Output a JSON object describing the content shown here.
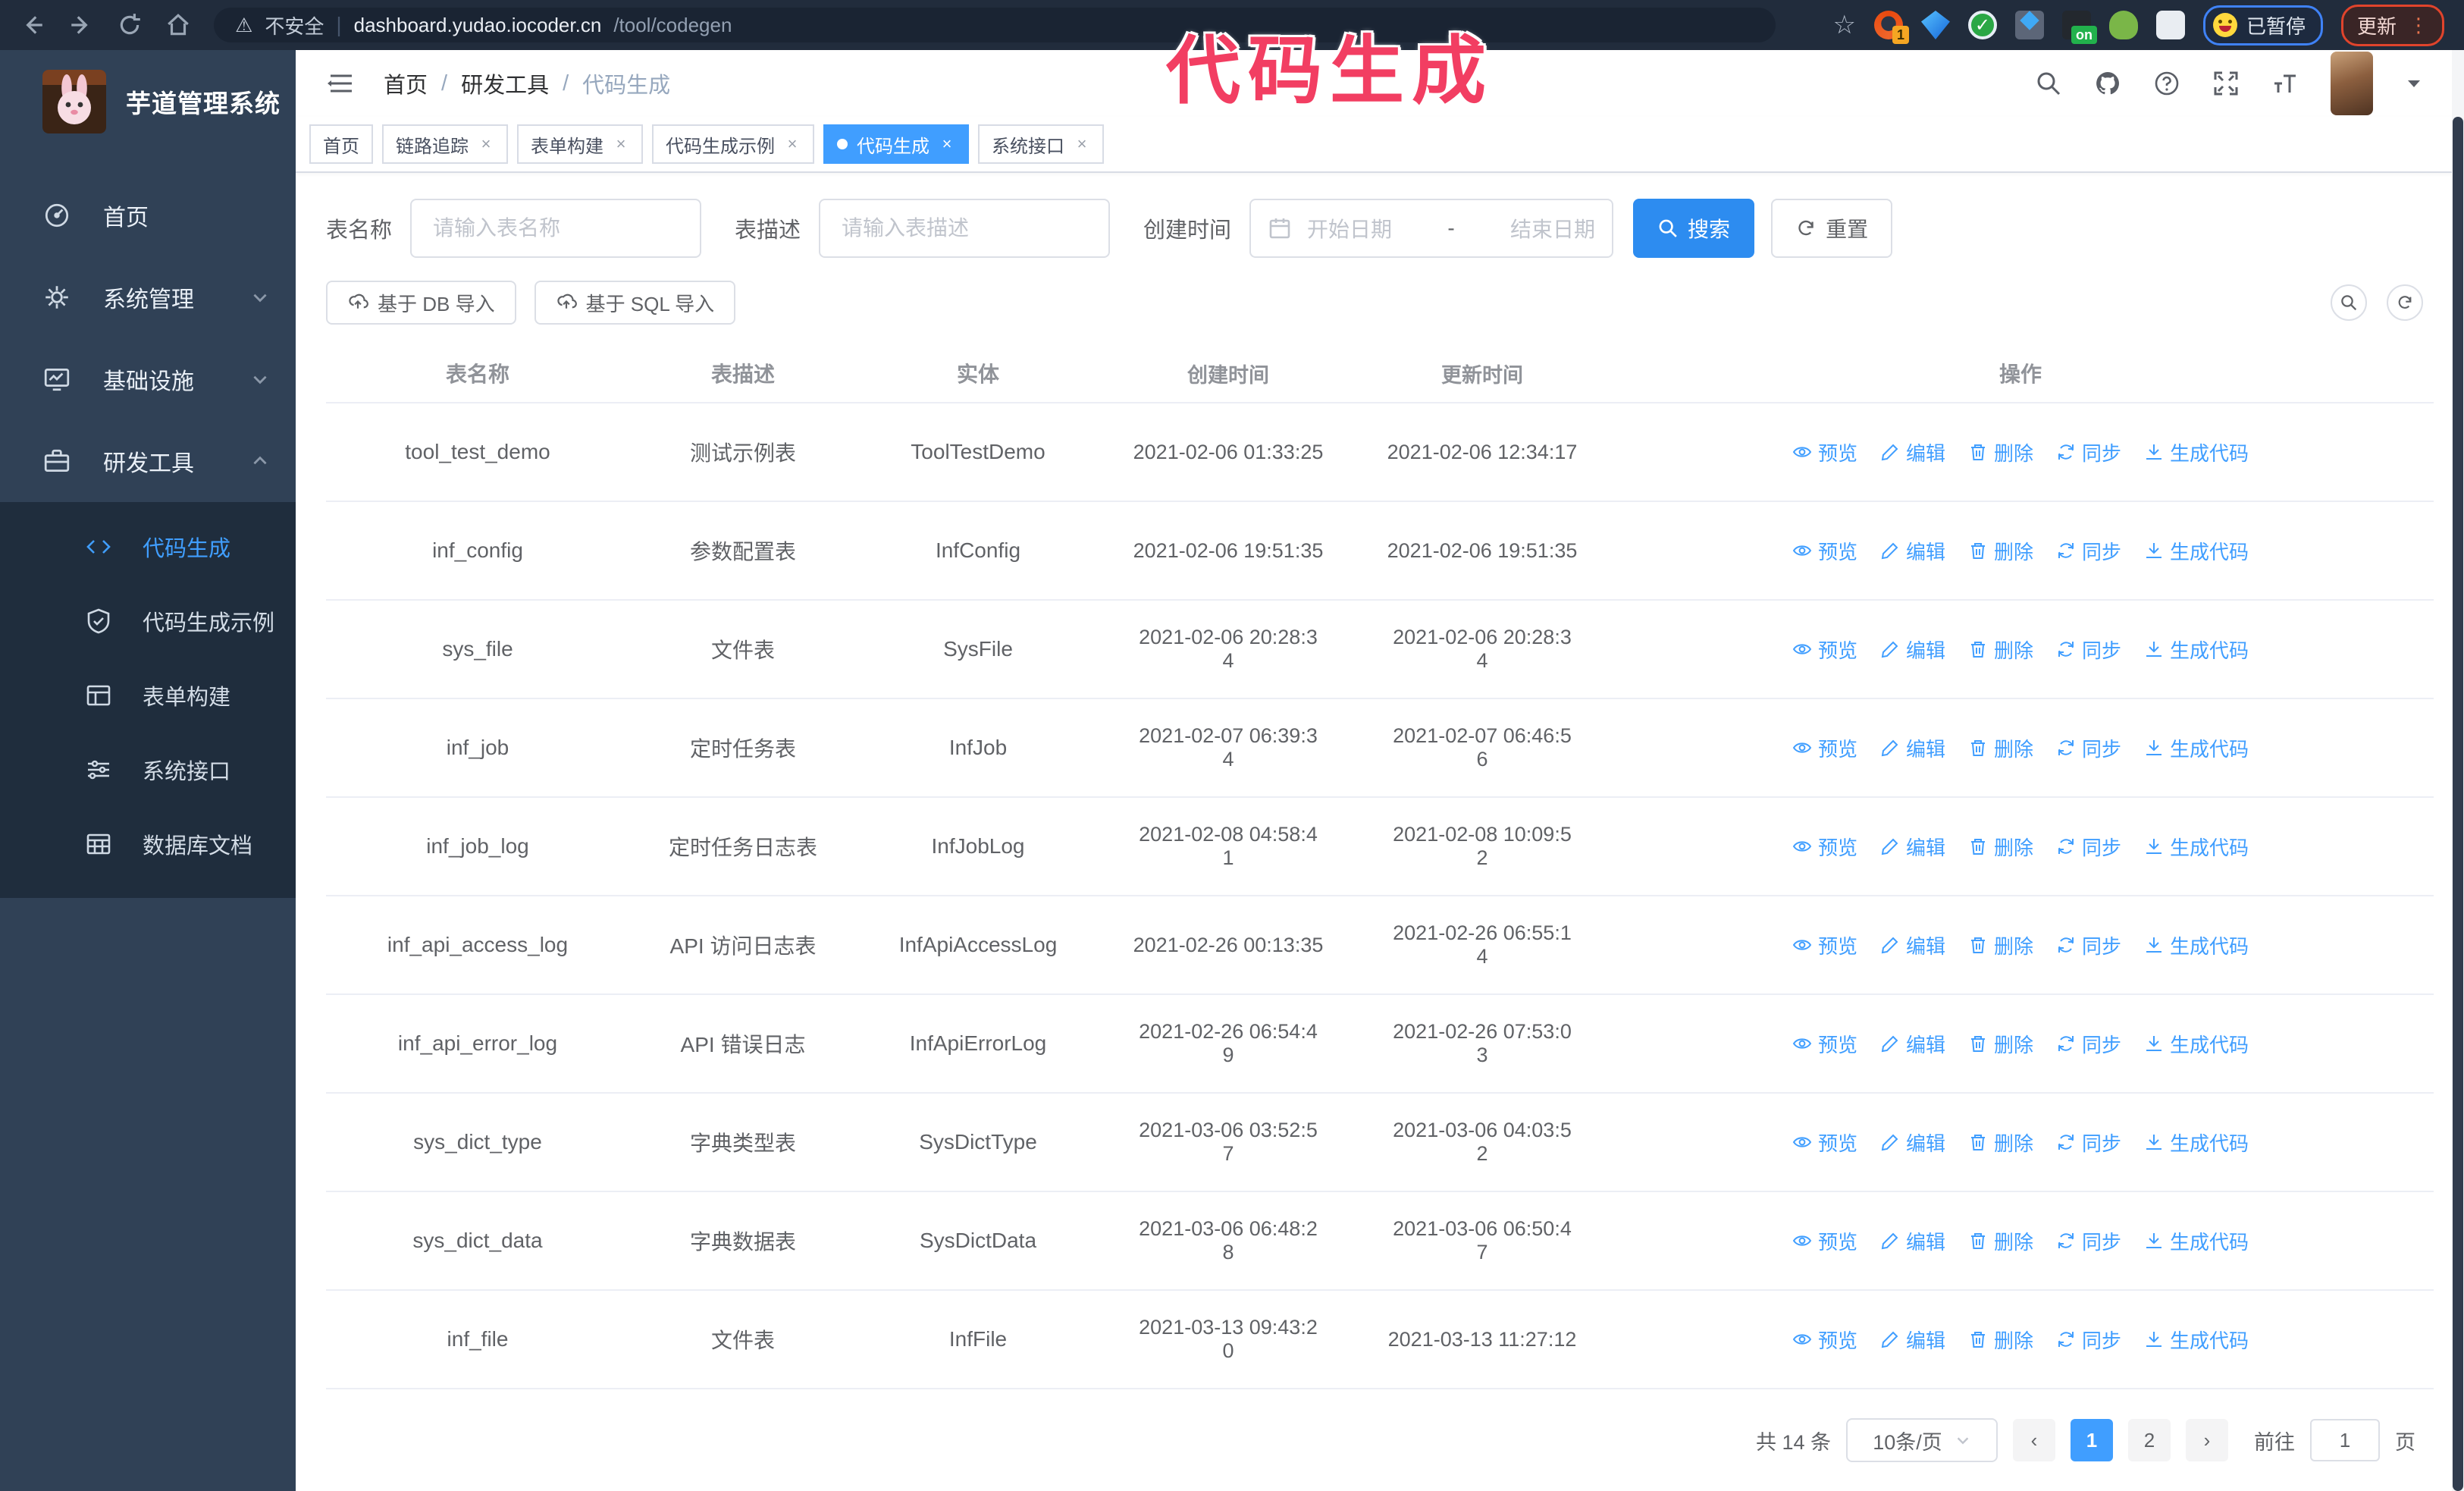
{
  "icons": {
    "close": "×",
    "slash": "/",
    "star": "☆",
    "warning": "⚠",
    "dots": "⋮",
    "prev": "‹",
    "next": "›",
    "range_dash": "-"
  },
  "browser": {
    "security_label": "不安全",
    "url_host": "dashboard.yudao.iocoder.cn",
    "url_path": "/tool/codegen",
    "ext_badge_count": "1",
    "ext_badge_on": "on",
    "paused_label": "已暂停",
    "update_label": "更新"
  },
  "annotation": {
    "text": "代码生成"
  },
  "sidebar": {
    "title": "芋道管理系统",
    "items": [
      {
        "label": "首页"
      },
      {
        "label": "系统管理"
      },
      {
        "label": "基础设施"
      },
      {
        "label": "研发工具"
      }
    ],
    "submenu": [
      {
        "label": "代码生成"
      },
      {
        "label": "代码生成示例"
      },
      {
        "label": "表单构建"
      },
      {
        "label": "系统接口"
      },
      {
        "label": "数据库文档"
      }
    ]
  },
  "header": {
    "breadcrumb": [
      "首页",
      "研发工具",
      "代码生成"
    ]
  },
  "tabs": [
    {
      "label": "首页"
    },
    {
      "label": "链路追踪"
    },
    {
      "label": "表单构建"
    },
    {
      "label": "代码生成示例"
    },
    {
      "label": "代码生成"
    },
    {
      "label": "系统接口"
    }
  ],
  "filters": {
    "name_label": "表名称",
    "name_placeholder": "请输入表名称",
    "desc_label": "表描述",
    "desc_placeholder": "请输入表描述",
    "time_label": "创建时间",
    "start_placeholder": "开始日期",
    "end_placeholder": "结束日期",
    "search_label": "搜索",
    "reset_label": "重置"
  },
  "toolbar": {
    "import_db": "基于 DB 导入",
    "import_sql": "基于 SQL 导入"
  },
  "table": {
    "columns": [
      "表名称",
      "表描述",
      "实体",
      "创建时间",
      "更新时间",
      "操作"
    ],
    "row_actions": [
      "预览",
      "编辑",
      "删除",
      "同步",
      "生成代码"
    ],
    "rows": [
      {
        "name": "tool_test_demo",
        "desc": "测试示例表",
        "entity": "ToolTestDemo",
        "created": "2021-02-06 01:33:25",
        "updated": "2021-02-06 12:34:17"
      },
      {
        "name": "inf_config",
        "desc": "参数配置表",
        "entity": "InfConfig",
        "created": "2021-02-06 19:51:35",
        "updated": "2021-02-06 19:51:35"
      },
      {
        "name": "sys_file",
        "desc": "文件表",
        "entity": "SysFile",
        "created": "2021-02-06 20:28:3\n4",
        "updated": "2021-02-06 20:28:3\n4"
      },
      {
        "name": "inf_job",
        "desc": "定时任务表",
        "entity": "InfJob",
        "created": "2021-02-07 06:39:3\n4",
        "updated": "2021-02-07 06:46:5\n6"
      },
      {
        "name": "inf_job_log",
        "desc": "定时任务日志表",
        "entity": "InfJobLog",
        "created": "2021-02-08 04:58:4\n1",
        "updated": "2021-02-08 10:09:5\n2"
      },
      {
        "name": "inf_api_access_log",
        "desc": "API 访问日志表",
        "entity": "InfApiAccessLog",
        "created": "2021-02-26 00:13:35",
        "updated": "2021-02-26 06:55:1\n4"
      },
      {
        "name": "inf_api_error_log",
        "desc": "API 错误日志",
        "entity": "InfApiErrorLog",
        "created": "2021-02-26 06:54:4\n9",
        "updated": "2021-02-26 07:53:0\n3"
      },
      {
        "name": "sys_dict_type",
        "desc": "字典类型表",
        "entity": "SysDictType",
        "created": "2021-03-06 03:52:5\n7",
        "updated": "2021-03-06 04:03:5\n2"
      },
      {
        "name": "sys_dict_data",
        "desc": "字典数据表",
        "entity": "SysDictData",
        "created": "2021-03-06 06:48:2\n8",
        "updated": "2021-03-06 06:50:4\n7"
      },
      {
        "name": "inf_file",
        "desc": "文件表",
        "entity": "InfFile",
        "created": "2021-03-13 09:43:2\n0",
        "updated": "2021-03-13 11:27:12"
      }
    ]
  },
  "pagination": {
    "total": "共 14 条",
    "page_size": "10条/页",
    "pages": [
      "1",
      "2"
    ],
    "goto_label": "前往",
    "goto_value": "1",
    "page_suffix": "页"
  }
}
